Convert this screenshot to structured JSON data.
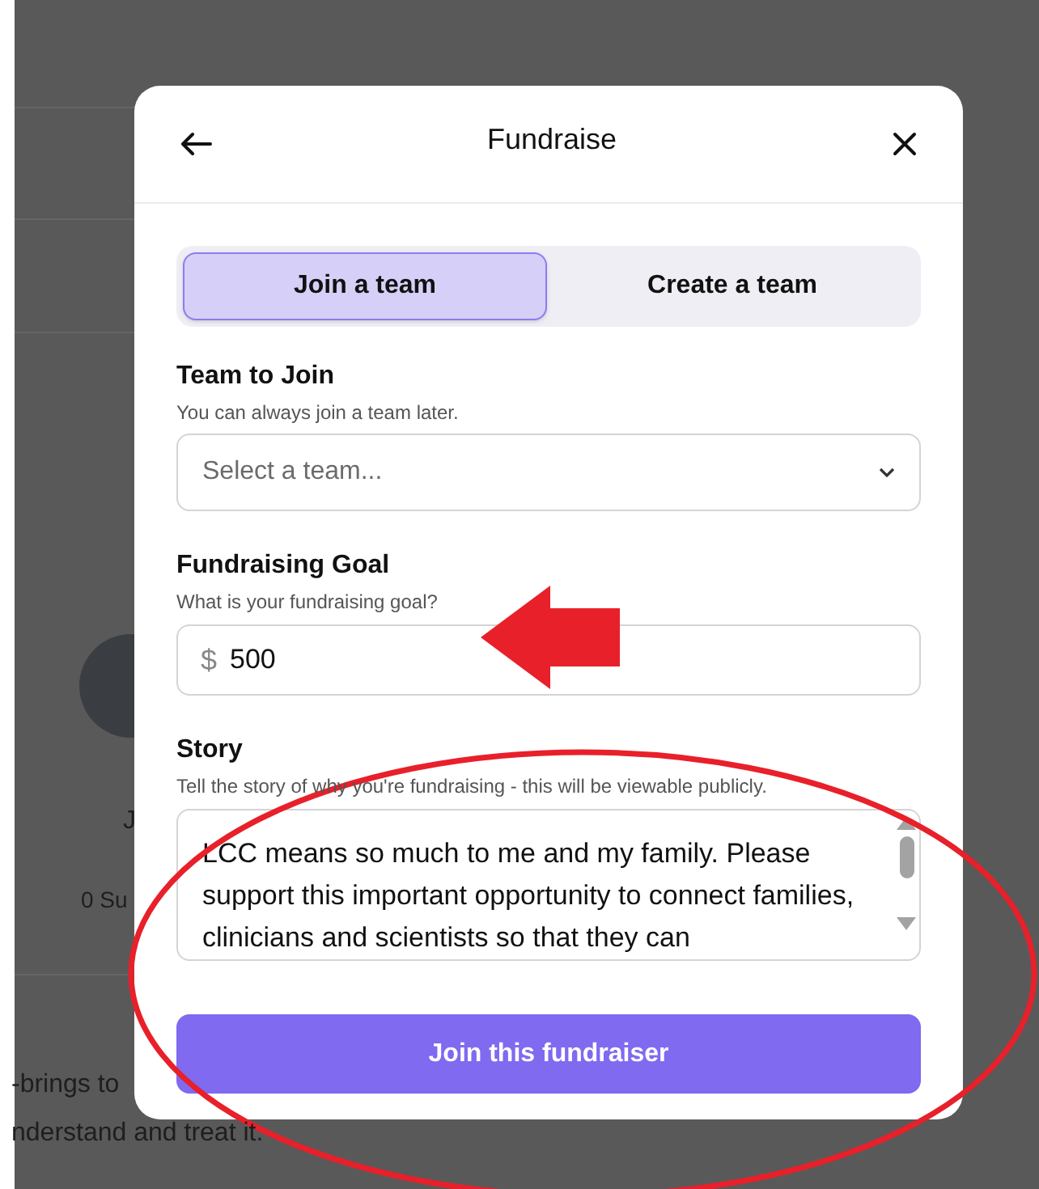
{
  "background": {
    "texts": [
      {
        "kind": "name",
        "text": "J"
      },
      {
        "kind": "stat",
        "text": "0 Su"
      },
      {
        "kind": "line1",
        "text": "-brings to"
      },
      {
        "kind": "line2",
        "text": "nderstand and treat it."
      }
    ]
  },
  "modal": {
    "title": "Fundraise",
    "tabs": [
      {
        "label": "Join a team",
        "selected": true
      },
      {
        "label": "Create a team",
        "selected": false
      }
    ],
    "team": {
      "label": "Team to Join",
      "hint": "You can always join a team later.",
      "placeholder": "Select a team..."
    },
    "goal": {
      "label": "Fundraising Goal",
      "hint": "What is your fundraising goal?",
      "currency": "$",
      "value": "500"
    },
    "story": {
      "label": "Story",
      "hint": "Tell the story of why you're fundraising - this will be viewable publicly.",
      "value": "LCC means so much to me and my family. Please support this important opportunity to connect families, clinicians and scientists so that they can"
    },
    "submit": "Join this fundraiser"
  }
}
